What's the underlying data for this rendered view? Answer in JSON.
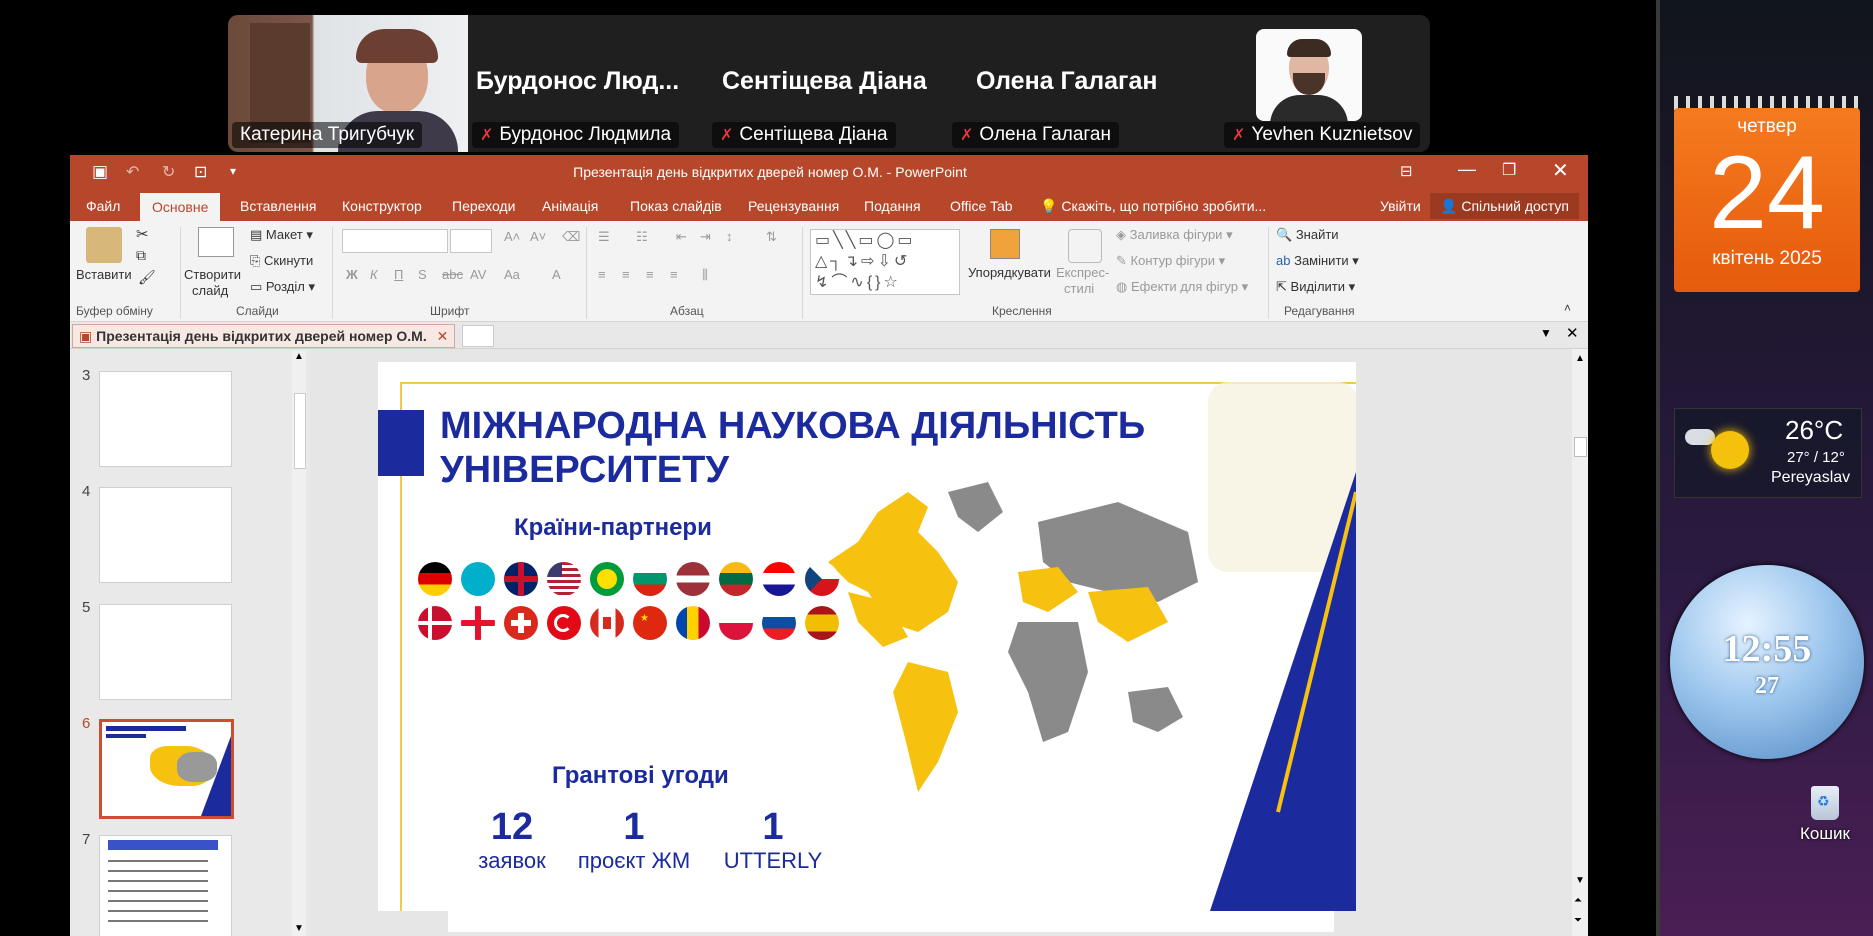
{
  "zoom": {
    "tiles": [
      {
        "big_name": "",
        "label": "Катерина Тригубчук"
      },
      {
        "big_name": "Бурдонос  Люд...",
        "label": "Бурдонос Людмила"
      },
      {
        "big_name": "Сентіщева Діана",
        "label": "Сентіщева Діана"
      },
      {
        "big_name": "Олена Галаган",
        "label": "Олена Галаган"
      },
      {
        "big_name": "",
        "label": "Yevhen Kuznietsov"
      }
    ]
  },
  "ppt": {
    "window_title": "Презентація день відкритих дверей номер О.М. - PowerPoint",
    "tabs": [
      "Файл",
      "Основне",
      "Вставлення",
      "Конструктор",
      "Переходи",
      "Анімація",
      "Показ слайдів",
      "Рецензування",
      "Подання",
      "Office Tab"
    ],
    "tell_me": "Скажіть, що потрібно зробити...",
    "sign_in": "Увійти",
    "share": "Спільний доступ",
    "ribbon": {
      "paste": "Вставити",
      "clipboard_group": "Буфер обміну",
      "new_slide_1": "Створити",
      "new_slide_2": "слайд",
      "layout": "Макет",
      "reset": "Скинути",
      "section": "Розділ",
      "slides_group": "Слайди",
      "font_group": "Шрифт",
      "paragraph_group": "Абзац",
      "arrange": "Упорядкувати",
      "quick_styles_1": "Експрес-",
      "quick_styles_2": "стилі",
      "shape_fill": "Заливка фігури",
      "shape_outline": "Контур фігури",
      "shape_effects": "Ефекти для фігур",
      "drawing_group": "Креслення",
      "find": "Знайти",
      "replace": "Замінити",
      "select": "Виділити",
      "editing_group": "Редагування"
    },
    "doc_tab": "Презентація день відкритих дверей номер О.М.",
    "thumb_numbers": [
      "3",
      "4",
      "5",
      "6",
      "7"
    ],
    "slide": {
      "title_line1": "МІЖНАРОДНА НАУКОВА ДІЯЛЬНІСТЬ",
      "title_line2": "УНІВЕРСИТЕТУ",
      "partners_heading": "Країни-партнери",
      "grants_heading": "Грантові угоди",
      "stats": [
        {
          "number": "12",
          "label": "заявок"
        },
        {
          "number": "1",
          "label": "проєкт ЖМ"
        },
        {
          "number": "1",
          "label": "UTTERLY"
        }
      ]
    },
    "colors": {
      "accent": "#b7472a",
      "slide_blue": "#1b2a9c",
      "map_yellow": "#f7c10f",
      "map_gray": "#8a8a8a"
    }
  },
  "desktop": {
    "calendar": {
      "weekday": "четвер",
      "day": "24",
      "month_year": "квітень 2025"
    },
    "weather": {
      "temp": "26°C",
      "range": "27° / 12°",
      "city": "Pereyaslav"
    },
    "clock": {
      "time": "12:55",
      "seconds": "27"
    },
    "recycle_bin": "Кошик"
  }
}
